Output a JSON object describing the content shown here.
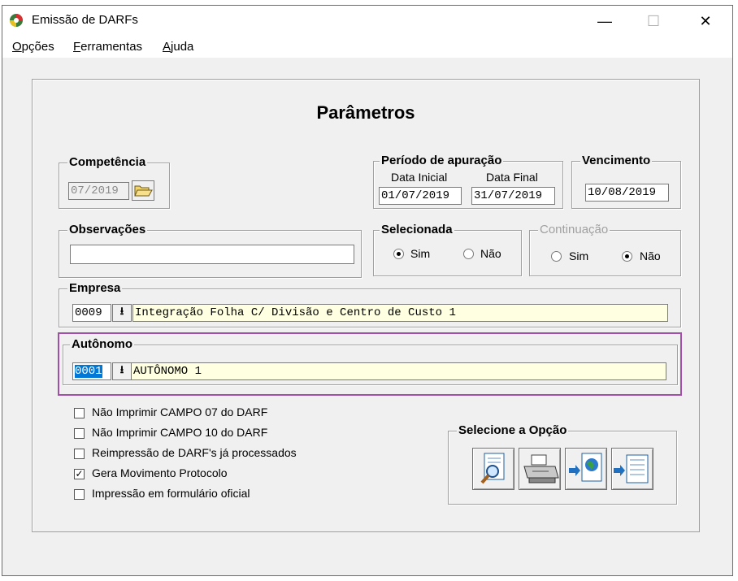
{
  "window": {
    "title": "Emissão de DARFs",
    "minimize_icon": "minimize-icon",
    "maximize_icon": "maximize-icon",
    "close_icon": "close-icon",
    "min_glyph": "—",
    "max_glyph": "☐",
    "close_glyph": "✕"
  },
  "menu": {
    "items": [
      {
        "first": "O",
        "rest": "pções"
      },
      {
        "first": "F",
        "rest": "erramentas"
      },
      {
        "first": "A",
        "rest": "juda"
      }
    ]
  },
  "heading": "Parâmetros",
  "competencia": {
    "legend": "Competência",
    "value": "07/2019"
  },
  "periodo": {
    "legend": "Período de apuração",
    "inicial_label": "Data Inicial",
    "final_label": "Data Final",
    "inicial": "01/07/2019",
    "final": "31/07/2019"
  },
  "vencimento": {
    "legend": "Vencimento",
    "value": "10/08/2019"
  },
  "observacoes": {
    "legend": "Observações",
    "value": ""
  },
  "selecionada": {
    "legend": "Selecionada",
    "sim": "Sim",
    "nao": "Não",
    "selected": "Sim"
  },
  "continuacao": {
    "legend": "Continuação",
    "sim": "Sim",
    "nao": "Não",
    "selected": "Não"
  },
  "empresa": {
    "legend": "Empresa",
    "code": "0009",
    "name": "Integração Folha C/ Divisão e Centro de Custo 1"
  },
  "autonomo": {
    "legend": "Autônomo",
    "code": "0001",
    "name": "AUTÔNOMO 1"
  },
  "options": [
    {
      "label": "Não Imprimir CAMPO 07 do DARF",
      "checked": false
    },
    {
      "label": "Não Imprimir CAMPO 10 do DARF",
      "checked": false
    },
    {
      "label": "Reimpressão de DARF's já processados",
      "checked": false
    },
    {
      "label": "Gera Movimento Protocolo",
      "checked": true
    },
    {
      "label": "Impressão em formulário oficial",
      "checked": false
    }
  ],
  "selecione": {
    "legend": "Selecione a Opção",
    "buttons": [
      "preview-icon",
      "printer-icon",
      "export-web-icon",
      "export-file-icon"
    ]
  },
  "colors": {
    "accent": "#a050a8",
    "selection": "#0078d7",
    "field_yellow": "#ffffe1"
  }
}
